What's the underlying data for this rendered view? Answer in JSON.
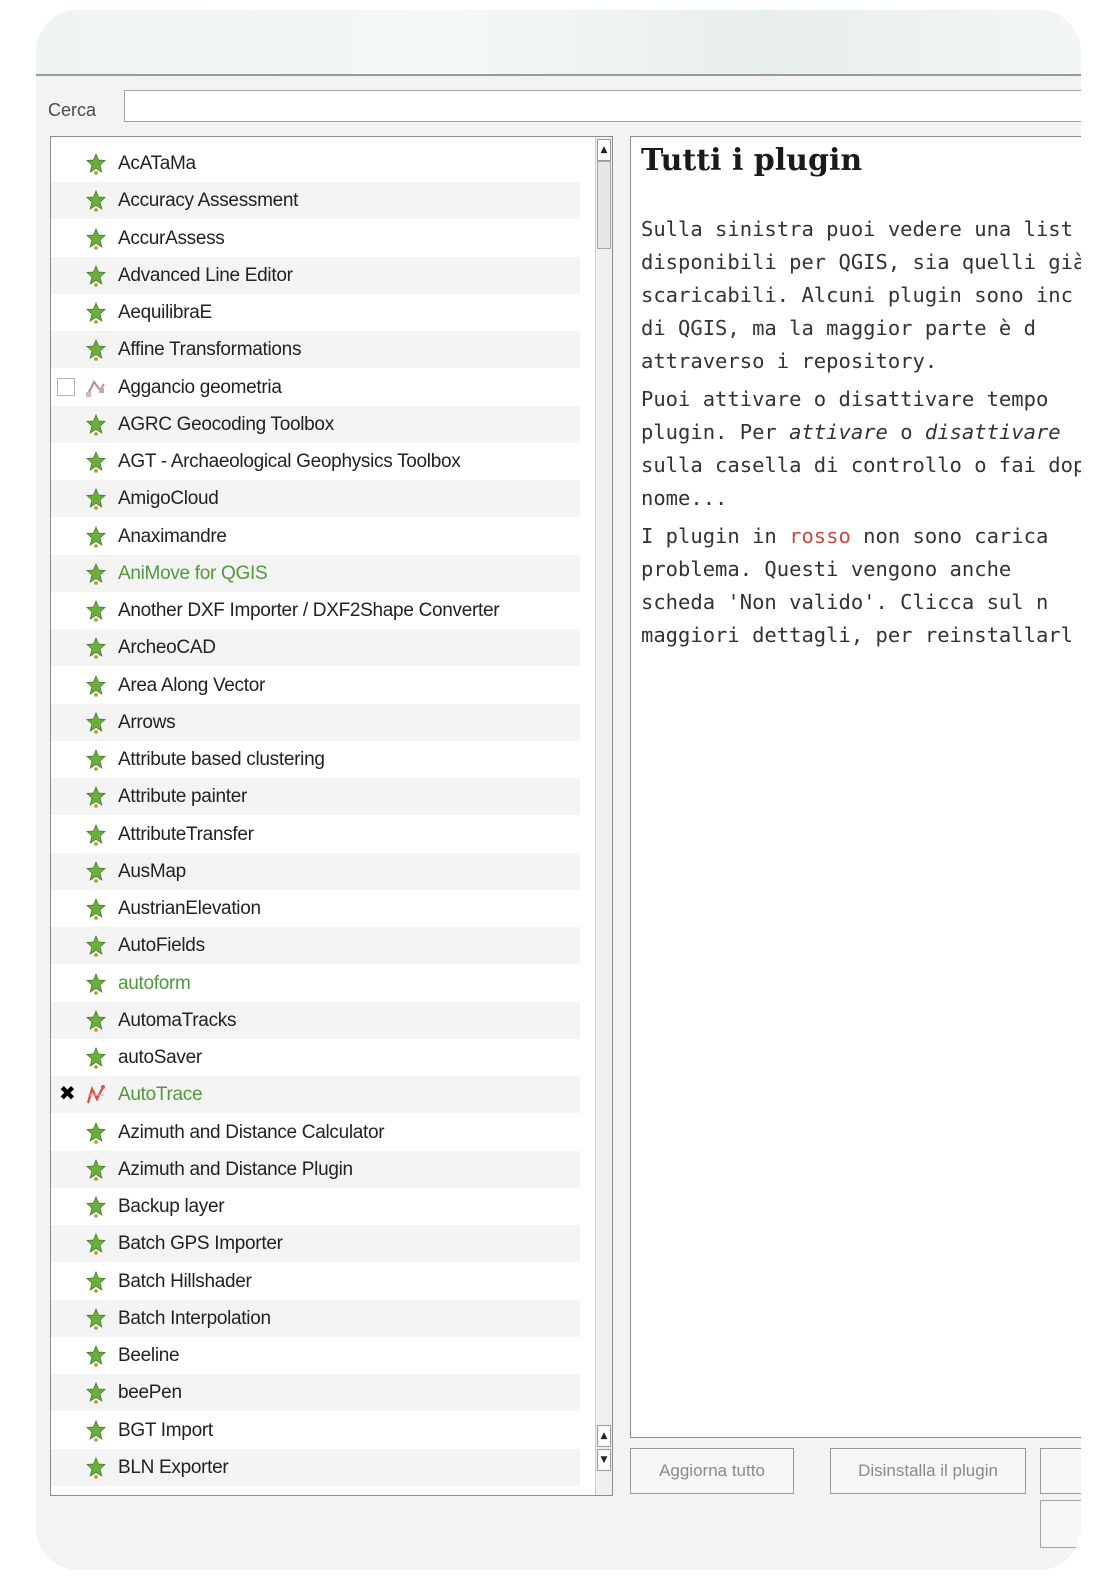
{
  "search": {
    "label": "Cerca",
    "value": ""
  },
  "plugins": [
    {
      "name": "AcATaMa",
      "icon": "plugin-puzzle-icon",
      "color": "normal",
      "checkbox": false
    },
    {
      "name": "Accuracy Assessment",
      "icon": "plugin-puzzle-icon",
      "color": "normal",
      "checkbox": false
    },
    {
      "name": "AccurAssess",
      "icon": "plugin-puzzle-icon",
      "color": "normal",
      "checkbox": false
    },
    {
      "name": "Advanced Line Editor",
      "icon": "plugin-puzzle-icon",
      "color": "normal",
      "checkbox": false
    },
    {
      "name": "AequilibraE",
      "icon": "plugin-puzzle-icon",
      "color": "normal",
      "checkbox": false
    },
    {
      "name": "Affine Transformations",
      "icon": "plugin-puzzle-icon",
      "color": "normal",
      "checkbox": false
    },
    {
      "name": "Aggancio geometria",
      "icon": "geometry-snapper-icon",
      "color": "normal",
      "checkbox": true
    },
    {
      "name": "AGRC Geocoding Toolbox",
      "icon": "plugin-puzzle-icon",
      "color": "normal",
      "checkbox": false
    },
    {
      "name": "AGT - Archaeological Geophysics Toolbox",
      "icon": "plugin-puzzle-icon",
      "color": "normal",
      "checkbox": false
    },
    {
      "name": "AmigoCloud",
      "icon": "plugin-puzzle-icon",
      "color": "normal",
      "checkbox": false
    },
    {
      "name": "Anaximandre",
      "icon": "plugin-puzzle-icon",
      "color": "normal",
      "checkbox": false
    },
    {
      "name": "AniMove for QGIS",
      "icon": "plugin-puzzle-icon",
      "color": "green",
      "checkbox": false
    },
    {
      "name": "Another DXF Importer / DXF2Shape Converter",
      "icon": "plugin-puzzle-icon",
      "color": "normal",
      "checkbox": false
    },
    {
      "name": "ArcheoCAD",
      "icon": "plugin-puzzle-icon",
      "color": "normal",
      "checkbox": false
    },
    {
      "name": "Area Along Vector",
      "icon": "plugin-puzzle-icon",
      "color": "normal",
      "checkbox": false
    },
    {
      "name": "Arrows",
      "icon": "plugin-puzzle-icon",
      "color": "normal",
      "checkbox": false
    },
    {
      "name": "Attribute based clustering",
      "icon": "plugin-puzzle-icon",
      "color": "normal",
      "checkbox": false
    },
    {
      "name": "Attribute painter",
      "icon": "plugin-puzzle-icon",
      "color": "normal",
      "checkbox": false
    },
    {
      "name": "AttributeTransfer",
      "icon": "plugin-puzzle-icon",
      "color": "normal",
      "checkbox": false
    },
    {
      "name": "AusMap",
      "icon": "plugin-puzzle-icon",
      "color": "normal",
      "checkbox": false
    },
    {
      "name": "AustrianElevation",
      "icon": "plugin-puzzle-icon",
      "color": "normal",
      "checkbox": false
    },
    {
      "name": "AutoFields",
      "icon": "plugin-puzzle-icon",
      "color": "normal",
      "checkbox": false
    },
    {
      "name": "autoform",
      "icon": "plugin-puzzle-icon",
      "color": "green",
      "checkbox": false
    },
    {
      "name": "AutomaTracks",
      "icon": "plugin-puzzle-icon",
      "color": "normal",
      "checkbox": false
    },
    {
      "name": "autoSaver",
      "icon": "plugin-puzzle-icon",
      "color": "normal",
      "checkbox": false
    },
    {
      "name": "AutoTrace",
      "icon": "autotrace-icon",
      "color": "green",
      "checkbox": "x"
    },
    {
      "name": "Azimuth and Distance Calculator",
      "icon": "plugin-puzzle-icon",
      "color": "normal",
      "checkbox": false
    },
    {
      "name": "Azimuth and Distance Plugin",
      "icon": "plugin-puzzle-icon",
      "color": "normal",
      "checkbox": false
    },
    {
      "name": "Backup layer",
      "icon": "plugin-puzzle-icon",
      "color": "normal",
      "checkbox": false
    },
    {
      "name": "Batch GPS Importer",
      "icon": "plugin-puzzle-icon",
      "color": "normal",
      "checkbox": false
    },
    {
      "name": "Batch Hillshader",
      "icon": "plugin-puzzle-icon",
      "color": "normal",
      "checkbox": false
    },
    {
      "name": "Batch Interpolation",
      "icon": "plugin-puzzle-icon",
      "color": "normal",
      "checkbox": false
    },
    {
      "name": "Beeline",
      "icon": "plugin-puzzle-icon",
      "color": "normal",
      "checkbox": false
    },
    {
      "name": "beePen",
      "icon": "plugin-puzzle-icon",
      "color": "normal",
      "checkbox": false
    },
    {
      "name": "BGT Import",
      "icon": "plugin-puzzle-icon",
      "color": "normal",
      "checkbox": false
    },
    {
      "name": "BLN Exporter",
      "icon": "plugin-puzzle-icon",
      "color": "normal",
      "checkbox": false
    }
  ],
  "description": {
    "title": "Tutti i plugin",
    "p1": [
      "Sulla sinistra puoi vedere una list",
      "disponibili per QGIS, sia quelli già",
      "scaricabili. Alcuni plugin sono inc",
      "di QGIS, ma la maggior parte è d",
      "attraverso i repository."
    ],
    "p2": {
      "l1": "Puoi attivare o disattivare tempo",
      "l2a": "plugin. Per ",
      "l2b": "attivare",
      "l2c": " o ",
      "l2d": "disattivare",
      "l3": "sulla casella di controllo o fai dop",
      "l4": "nome..."
    },
    "p3": {
      "l1a": "I plugin in ",
      "l1b": "rosso",
      "l1c": " non sono carica",
      "l2": "problema. Questi vengono anche",
      "l3": "scheda 'Non valido'. Clicca sul n",
      "l4": "maggiori dettagli, per reinstallarl"
    }
  },
  "buttons": {
    "upgrade_all": "Aggiorna tutto",
    "uninstall": "Disinstalla il plugin"
  },
  "colors": {
    "green_text": "#4f9a3b",
    "red_text": "#c74b3d",
    "puzzle_green": "#6cae3c"
  }
}
